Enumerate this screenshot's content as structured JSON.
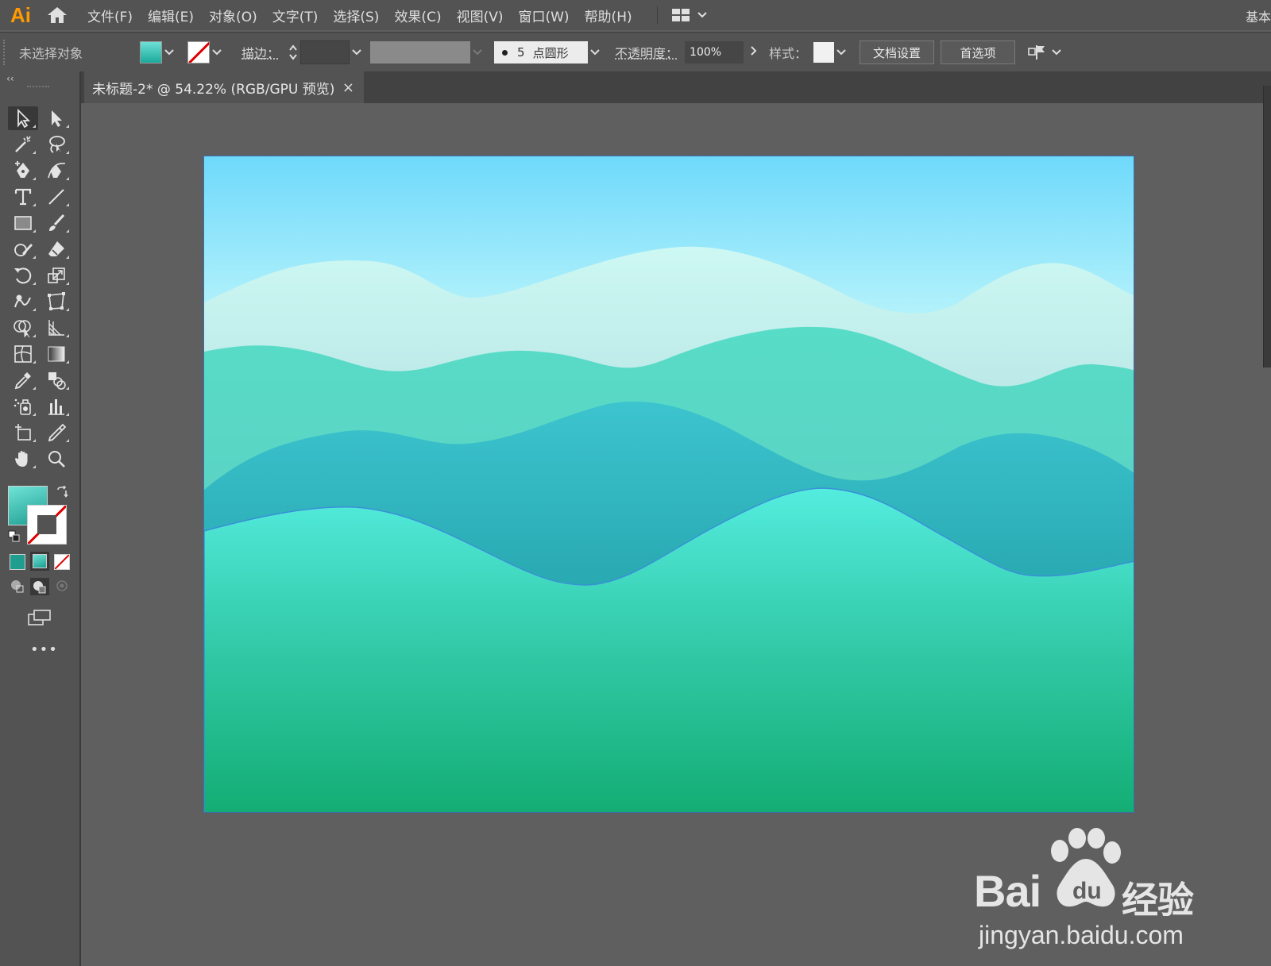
{
  "app": {
    "logo": "Ai",
    "workspace": "基本"
  },
  "menu": [
    {
      "label": "文件(F)"
    },
    {
      "label": "编辑(E)"
    },
    {
      "label": "对象(O)"
    },
    {
      "label": "文字(T)"
    },
    {
      "label": "选择(S)"
    },
    {
      "label": "效果(C)"
    },
    {
      "label": "视图(V)"
    },
    {
      "label": "窗口(W)"
    },
    {
      "label": "帮助(H)"
    }
  ],
  "control": {
    "selection": "未选择对象",
    "stroke_label": "描边：",
    "brush_size": "5",
    "brush_name": "点圆形",
    "opacity_label": "不透明度：",
    "opacity_value": "100%",
    "style_label": "样式：",
    "doc_setup": "文档设置",
    "preferences": "首选项"
  },
  "document": {
    "tab_title": "未标题-2* @ 54.22% (RGB/GPU 预览)",
    "close_glyph": "×"
  },
  "tools_more": "•••",
  "colors": {
    "sky_top": "#6fd9fb",
    "sky_mid": "#c9fbf7",
    "front_wave_top": "#52e8d9",
    "front_wave_bottom": "#15ad78",
    "selection_outline": "#3a6fae"
  },
  "icons": [
    "selection-tool-icon",
    "direct-selection-tool-icon",
    "magic-wand-icon",
    "lasso-icon",
    "pen-icon",
    "curvature-icon",
    "type-icon",
    "line-icon",
    "rectangle-icon",
    "paintbrush-icon",
    "shaper-icon",
    "eraser-icon",
    "rotate-icon",
    "scale-icon",
    "warp-icon",
    "free-transform-icon",
    "shape-builder-icon",
    "perspective-grid-icon",
    "mesh-icon",
    "gradient-icon",
    "eyedropper-icon",
    "blend-icon",
    "symbol-sprayer-icon",
    "column-graph-icon",
    "artboard-icon",
    "slice-icon",
    "hand-icon",
    "zoom-icon"
  ],
  "watermark": {
    "brand": "Bai",
    "brand_cn": "经验",
    "url": "jingyan.baidu.com"
  }
}
